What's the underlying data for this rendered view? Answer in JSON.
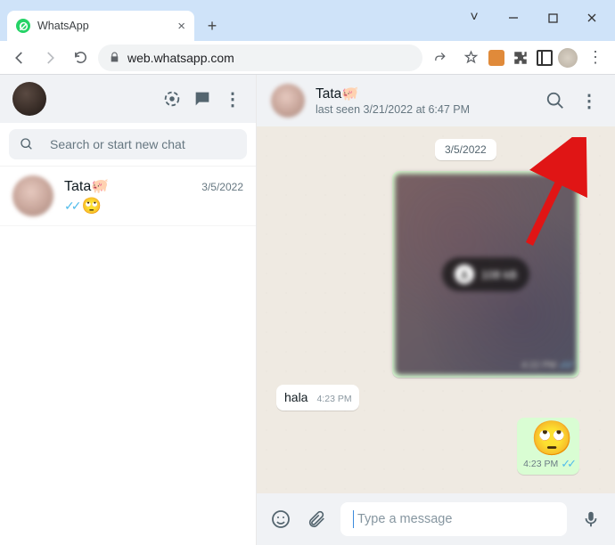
{
  "browser": {
    "tab_title": "WhatsApp",
    "url": "web.whatsapp.com"
  },
  "left": {
    "search_placeholder": "Search or start new chat",
    "chat": {
      "name": "Tata🐖",
      "date": "3/5/2022",
      "preview_emoji": "🙄"
    }
  },
  "chat_header": {
    "name": "Tata🐖",
    "status": "last seen 3/21/2022 at 6:47 PM"
  },
  "messages": {
    "date_chip": "3/5/2022",
    "image": {
      "size_label": "108 kB",
      "time": "4:22 PM"
    },
    "incoming": {
      "text": "hala",
      "time": "4:23 PM"
    },
    "emoji_out": {
      "emoji": "🙄",
      "time": "4:23 PM"
    }
  },
  "composer": {
    "placeholder": "Type a message"
  }
}
